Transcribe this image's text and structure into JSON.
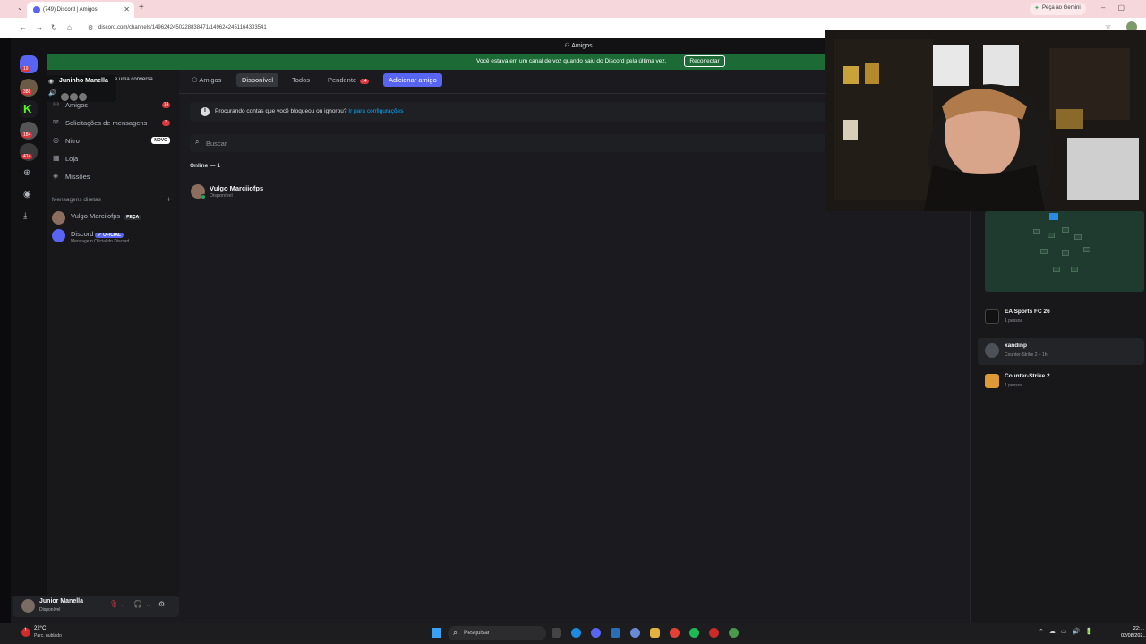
{
  "browser": {
    "tab_title": "(749) Discord | Amigos",
    "new_tab": "+",
    "url": "discord.com/channels/1496242450228838471/1496242451164303541",
    "gemini_button": "Peça ao Gemini"
  },
  "window": {
    "title": "Amigos",
    "notice_text": "Você estava em um canal de voz quando saiu do Discord pela última vez.",
    "reconnect_label": "Reconectar"
  },
  "rail": {
    "badges": [
      "19",
      "388",
      "184",
      "414"
    ]
  },
  "tooltip": {
    "server_name": "Juninho Manella",
    "partial_text": "e uma conversa"
  },
  "sidebar": {
    "items": [
      {
        "label": "Amigos",
        "badge": "14",
        "icon": "friends-icon"
      },
      {
        "label": "Solicitações de mensagens",
        "badge": "3",
        "icon": "message-requests-icon"
      },
      {
        "label": "Nitro",
        "badge": "NOVO",
        "icon": "nitro-icon"
      },
      {
        "label": "Loja",
        "icon": "shop-icon"
      },
      {
        "label": "Missões",
        "icon": "quests-icon"
      }
    ],
    "dm_header": "Mensagens diretas",
    "dm_add": "+",
    "dms": [
      {
        "name": "Vulgo Marciiofps",
        "tag": "PEÇA",
        "sub": ""
      },
      {
        "name": "Discord",
        "tag": "✓ OFICIAL",
        "sub": "Mensagem Oficial do Discord"
      }
    ]
  },
  "user_panel": {
    "name": "Junior Manella",
    "status": "Disponível"
  },
  "main": {
    "tabs": {
      "amigos": "Amigos",
      "disponivel": "Disponível",
      "todos": "Todos",
      "pendente": "Pendente",
      "pendente_badge": "14",
      "adicionar": "Adicionar amigo"
    },
    "info_text": "Procurando contas que você bloqueou ou ignorou?",
    "info_link": "Ir para configurações",
    "search_placeholder": "Buscar",
    "online_header": "Online — 1",
    "friends": [
      {
        "name": "Vulgo Marciiofps",
        "status": "Disponível"
      }
    ]
  },
  "activity": [
    {
      "name": "EA Sports FC 26",
      "sub": "1 pessoa"
    },
    {
      "name": "xandinp",
      "sub": "Counter-Strike 2 – 1h"
    },
    {
      "name": "Counter-Strike 2",
      "sub": "1 pessoa"
    }
  ],
  "taskbar": {
    "badge": "1",
    "temperature": "22°C",
    "weather": "Parc. nublado",
    "search_placeholder": "Pesquisar",
    "time": "22:...",
    "date": "02/08/202..."
  },
  "colors": {
    "blurple": "#5865f2",
    "online_green": "#23a55a",
    "badge_red": "#da373c",
    "notice_green": "#1c6b36"
  }
}
